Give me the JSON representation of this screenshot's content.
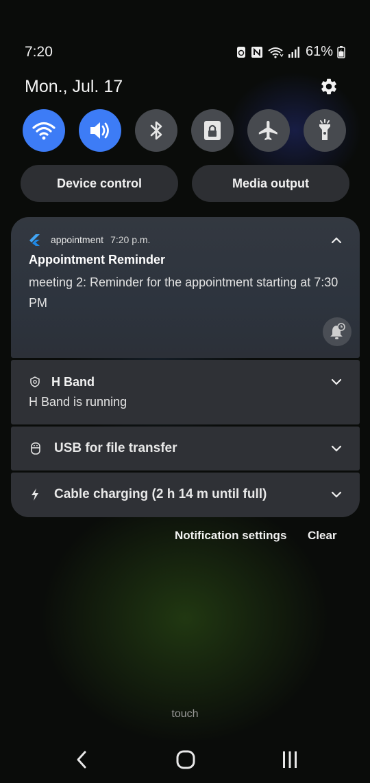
{
  "status_bar": {
    "time": "7:20",
    "battery_percent": "61%",
    "icons": [
      "battery-saver-icon",
      "nfc-icon",
      "wifi-icon",
      "signal-icon",
      "battery-icon"
    ]
  },
  "header": {
    "date": "Mon., Jul. 17",
    "settings_icon": "gear-icon"
  },
  "quick_toggles": [
    {
      "name": "wifi",
      "state": "on",
      "icon": "wifi-icon"
    },
    {
      "name": "sound",
      "state": "on",
      "icon": "volume-icon"
    },
    {
      "name": "bluetooth",
      "state": "off",
      "icon": "bluetooth-icon"
    },
    {
      "name": "screen-lock",
      "state": "off",
      "icon": "lock-icon"
    },
    {
      "name": "airplane",
      "state": "off",
      "icon": "airplane-icon"
    },
    {
      "name": "flashlight",
      "state": "off",
      "icon": "flashlight-icon"
    }
  ],
  "controls": {
    "device_control": "Device control",
    "media_output": "Media output"
  },
  "notifications": {
    "appointment": {
      "app": "appointment",
      "time": "7:20 p.m.",
      "title": "Appointment Reminder",
      "text": "meeting 2: Reminder for the appointment starting at 7:30 PM"
    },
    "hband": {
      "app": "H Band",
      "text": "H Band is running"
    },
    "usb": {
      "label": "USB for file transfer"
    },
    "charging": {
      "label": "Cable charging (2 h 14 m until full)"
    }
  },
  "footer": {
    "notification_settings": "Notification settings",
    "clear": "Clear"
  },
  "touch_label": "touch",
  "colors": {
    "accent": "#3d7cf6",
    "toggle_off": "#474a4f",
    "card_bg": "#2f3136"
  }
}
